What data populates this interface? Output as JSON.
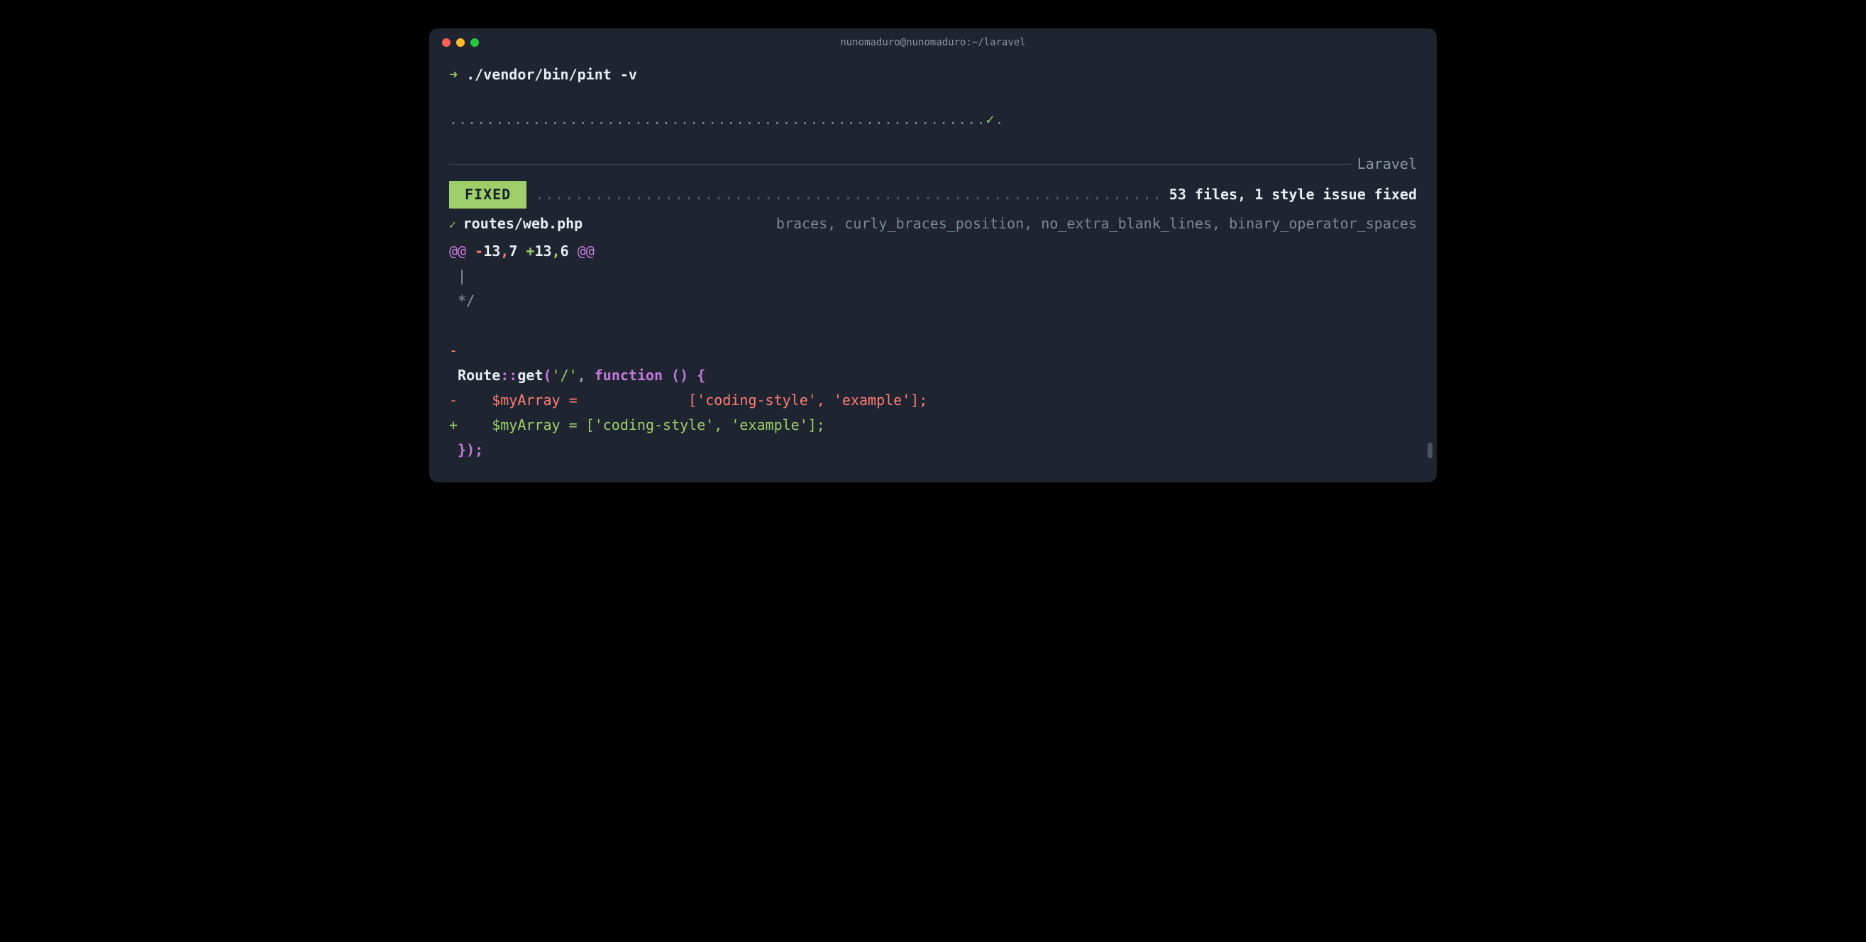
{
  "window": {
    "title": "nunomaduro@nunomaduro:~/laravel"
  },
  "prompt": {
    "arrow": "➜",
    "command": "./vendor/bin/pint -v"
  },
  "progress": {
    "dots_before": "..........................................................",
    "check": "✓",
    "dots_after": "."
  },
  "preset": "Laravel",
  "summary": {
    "badge": "FIXED",
    "dots": "..........................................................................",
    "text": "53 files, 1 style issue fixed"
  },
  "file": {
    "check": "✓",
    "path": "routes/web.php",
    "rules": "braces, curly_braces_position, no_extra_blank_lines, binary_operator_spaces"
  },
  "diff": {
    "hunk_at1": "@@",
    "hunk_minus": "-13,7",
    "hunk_plus": "+13,6",
    "hunk_at2": "@@",
    "lines": {
      "ctx1": " |",
      "ctx2": " */",
      "blank": " ",
      "removed_blank": "-",
      "route_prefix": " ",
      "route_class": "Route",
      "route_sep": "::",
      "route_method": "get",
      "route_open": "(",
      "route_path": "'/'",
      "route_comma": ", ",
      "route_fn": "function",
      "route_paren": " () {",
      "removed_line_prefix": "-    ",
      "removed_var": "$myArray",
      "removed_eq": " =             ",
      "removed_arr": "['coding-style', 'example'];",
      "added_line_prefix": "+    ",
      "added_var": "$myArray",
      "added_eq": " = ",
      "added_arr": "['coding-style', 'example'];",
      "close": " });"
    }
  }
}
